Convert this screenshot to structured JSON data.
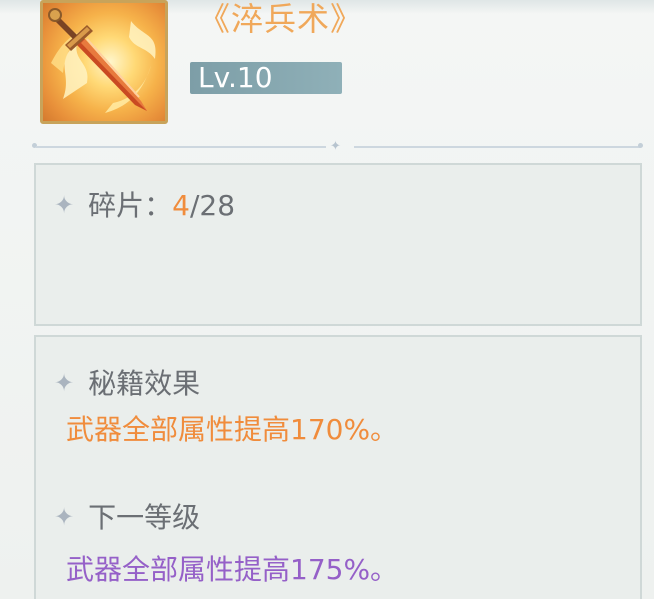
{
  "skill": {
    "title": "《淬兵术》",
    "level": "Lv.10",
    "icon": "flaming-sword-icon"
  },
  "fragments": {
    "label": "碎片：",
    "current": "4",
    "separator": "/",
    "total": "28"
  },
  "effects": {
    "current_label": "秘籍效果",
    "current_text": "武器全部属性提高170%。",
    "next_label": "下一等级",
    "next_text": "武器全部属性提高175%。"
  },
  "colors": {
    "accent_orange": "#f08c3c",
    "next_purple": "#9560c8",
    "title_gold": "#f0a85a",
    "badge_teal": "#8fb0b8"
  }
}
